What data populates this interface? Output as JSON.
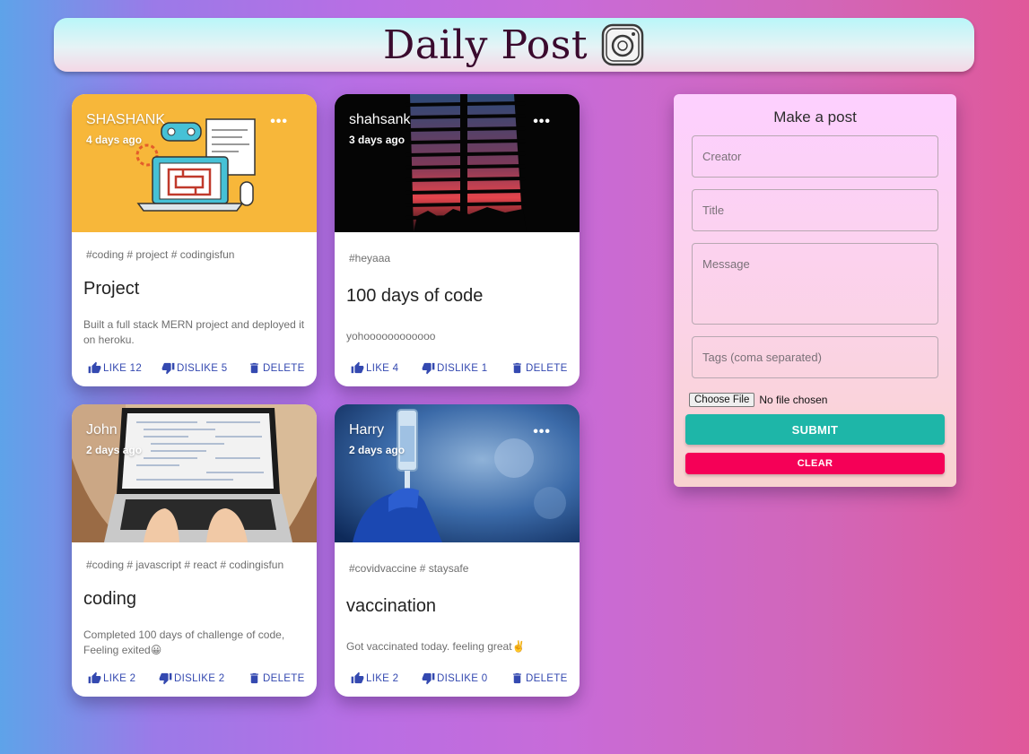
{
  "app": {
    "title": "Daily Post"
  },
  "posts": [
    {
      "creator": "SHASHANK",
      "time": "4 days ago",
      "more": "•••",
      "tags": "#coding # project # codingisfun",
      "title": "Project",
      "message": "Built a full stack MERN project and deployed it on heroku.",
      "like": "LIKE 12",
      "dislike": "DISLIKE 5",
      "delete": "DELETE",
      "image": "coding-illustration"
    },
    {
      "creator": "shahsank",
      "time": "3 days ago",
      "more": "•••",
      "tags": "#heyaaa",
      "title": "100 days of code",
      "message": "yohoooooooooooo",
      "like": "LIKE 4",
      "dislike": "DISLIKE 1",
      "delete": "DELETE",
      "image": "window-blinds-sunset"
    },
    {
      "creator": "John",
      "time": "2 days ago",
      "more": "•••",
      "tags": "#coding # javascript # react # codingisfun",
      "title": "coding",
      "message": "Completed 100 days of challenge of code, Feeling exited😀",
      "like": "LIKE 2",
      "dislike": "DISLIKE 2",
      "delete": "DELETE",
      "image": "laptop-typing"
    },
    {
      "creator": "Harry",
      "time": "2 days ago",
      "more": "•••",
      "tags": "#covidvaccine # staysafe",
      "title": "vaccination",
      "message": "Got vaccinated today. feeling great✌️",
      "like": "LIKE 2",
      "dislike": "DISLIKE 0",
      "delete": "DELETE",
      "image": "vaccine-syringe"
    }
  ],
  "form": {
    "title": "Make a post",
    "creator_placeholder": "Creator",
    "title_placeholder": "Title",
    "message_placeholder": "Message",
    "tags_placeholder": "Tags (coma separated)",
    "file_button": "Choose File",
    "file_status": "No file chosen",
    "submit": "SUBMIT",
    "clear": "CLEAR"
  },
  "colors": {
    "accent_blue": "#3449b0",
    "submit": "#1eb6a8",
    "clear": "#f50057",
    "title": "#3a0a2e"
  }
}
